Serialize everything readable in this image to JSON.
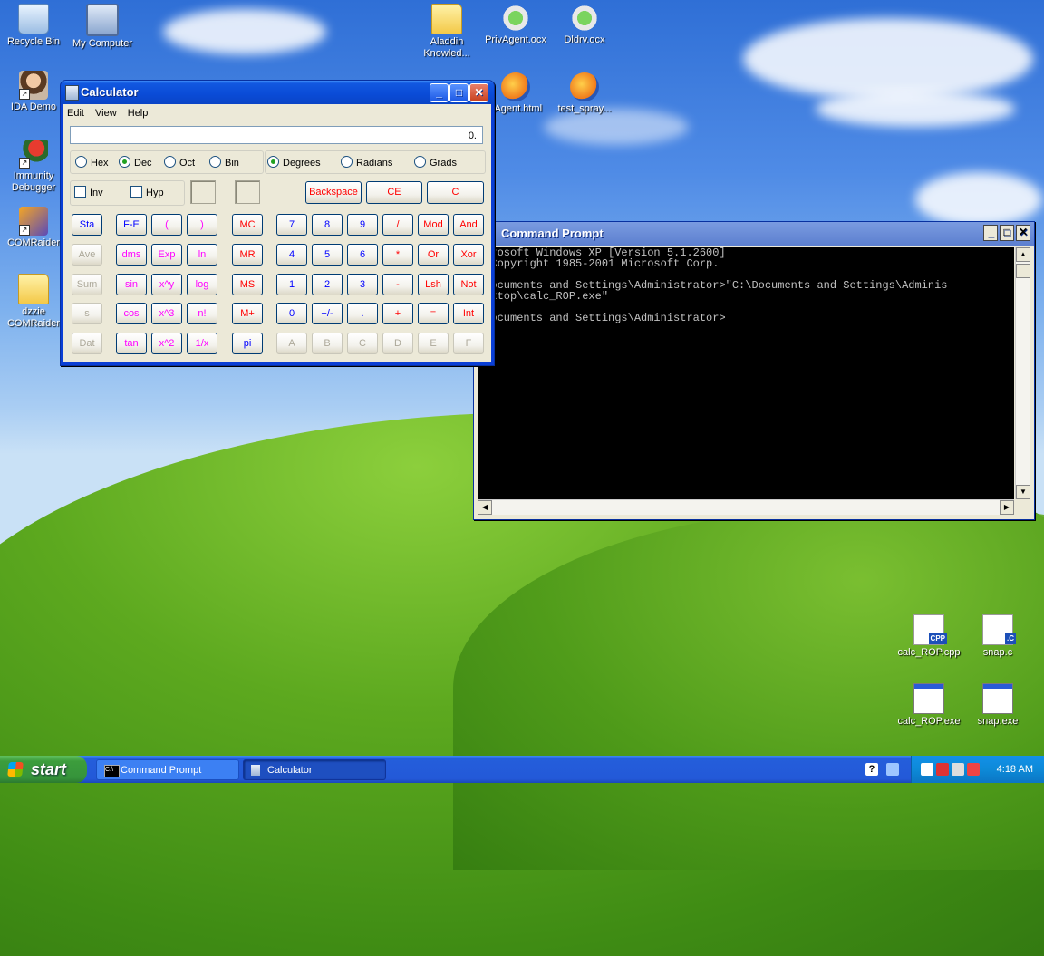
{
  "desktop": {
    "icons_left": [
      {
        "label": "Recycle Bin",
        "icon": "recycle-bin-icon"
      },
      {
        "label": "My Computer",
        "icon": "computer-icon"
      },
      {
        "label": "IDA Demo",
        "icon": "ida-icon"
      },
      {
        "label": "Immunity Debugger",
        "icon": "debugger-icon"
      },
      {
        "label": "COMRaider",
        "icon": "comraider-icon"
      },
      {
        "label": "dzzie COMRaider",
        "icon": "folder-icon"
      }
    ],
    "icons_top": [
      {
        "label": "Aladdin Knowled...",
        "icon": "folder-icon"
      },
      {
        "label": "PrivAgent.ocx",
        "icon": "ocx-file-icon"
      },
      {
        "label": "Dldrv.ocx",
        "icon": "ocx-file-icon"
      },
      {
        "label": "vAgent.html",
        "icon": "firefox-html-icon"
      },
      {
        "label": "test_spray...",
        "icon": "firefox-html-icon"
      }
    ],
    "icons_bottom": [
      {
        "label": "calc_ROP.cpp",
        "icon": "cpp-file-icon",
        "tag": "CPP"
      },
      {
        "label": "snap.c",
        "icon": "c-file-icon",
        "tag": ".C"
      },
      {
        "label": "calc_ROP.exe",
        "icon": "exe-file-icon"
      },
      {
        "label": "snap.exe",
        "icon": "exe-file-icon"
      }
    ]
  },
  "calculator": {
    "title": "Calculator",
    "menu": [
      "Edit",
      "View",
      "Help"
    ],
    "display": "0.",
    "base_modes": [
      "Hex",
      "Dec",
      "Oct",
      "Bin"
    ],
    "selected_base": "Dec",
    "angle_modes": [
      "Degrees",
      "Radians",
      "Grads"
    ],
    "selected_angle": "Degrees",
    "checks": [
      "Inv",
      "Hyp"
    ],
    "clear_buttons": [
      "Backspace",
      "CE",
      "C"
    ],
    "stat_buttons": [
      "Sta",
      "Ave",
      "Sum",
      "s",
      "Dat"
    ],
    "sci_buttons": [
      [
        "F-E",
        "(",
        ")"
      ],
      [
        "dms",
        "Exp",
        "ln"
      ],
      [
        "sin",
        "x^y",
        "log"
      ],
      [
        "cos",
        "x^3",
        "n!"
      ],
      [
        "tan",
        "x^2",
        "1/x"
      ]
    ],
    "mem_buttons": [
      "MC",
      "MR",
      "MS",
      "M+",
      "pi"
    ],
    "num_buttons": [
      [
        "7",
        "8",
        "9",
        "/",
        "Mod",
        "And"
      ],
      [
        "4",
        "5",
        "6",
        "*",
        "Or",
        "Xor"
      ],
      [
        "1",
        "2",
        "3",
        "-",
        "Lsh",
        "Not"
      ],
      [
        "0",
        "+/-",
        ".",
        "+",
        "=",
        "Int"
      ],
      [
        "A",
        "B",
        "C",
        "D",
        "E",
        "F"
      ]
    ]
  },
  "cmd": {
    "title": "Command Prompt",
    "lines": [
      "icrosoft Windows XP [Version 5.1.2600]",
      ") Copyright 1985-2001 Microsoft Corp.",
      "",
      "\\Documents and Settings\\Administrator>\"C:\\Documents and Settings\\Adminis",
      "esktop\\calc_ROP.exe\"",
      "",
      "\\Documents and Settings\\Administrator>"
    ]
  },
  "taskbar": {
    "start_label": "start",
    "tasks": [
      {
        "label": "Command Prompt",
        "icon": "cmd-icon"
      },
      {
        "label": "Calculator",
        "icon": "calculator-icon"
      }
    ],
    "clock": "4:18 AM"
  },
  "colors": {
    "xp_blue": "#0a4bd6",
    "start_green": "#3c9d3c",
    "calc_blue_text": "#0000ff",
    "calc_red_text": "#ff0000",
    "calc_magenta_text": "#ff00ff"
  }
}
